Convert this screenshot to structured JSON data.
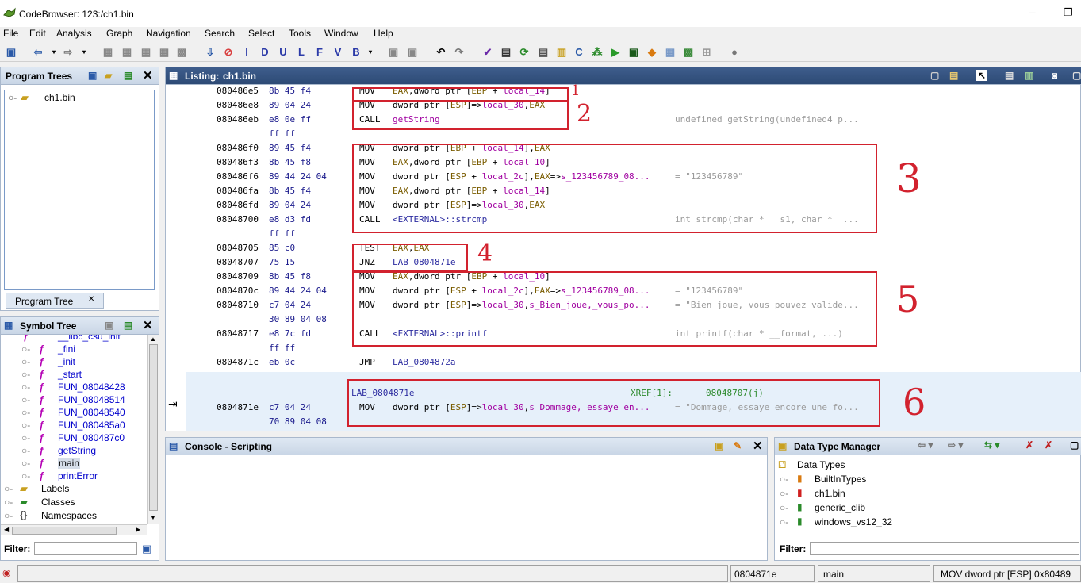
{
  "window": {
    "title": "CodeBrowser: 123:/ch1.bin",
    "min": "─",
    "max": "❐"
  },
  "menu": [
    "File",
    "Edit",
    "Analysis",
    "Graph",
    "Navigation",
    "Search",
    "Select",
    "Tools",
    "Window",
    "Help"
  ],
  "program_trees": {
    "title": "Program Trees",
    "root": "ch1.bin",
    "tab": "Program Tree"
  },
  "symbol_tree": {
    "title": "Symbol Tree",
    "functions": [
      "__libc_csu_init",
      "_fini",
      "_init",
      "_start",
      "FUN_08048428",
      "FUN_08048514",
      "FUN_08048540",
      "FUN_080485a0",
      "FUN_080487c0",
      "getString",
      "main",
      "printError"
    ],
    "folders": [
      "Labels",
      "Classes",
      "Namespaces"
    ],
    "filter_label": "Filter:"
  },
  "listing": {
    "title": "Listing:",
    "file": "ch1.bin",
    "lines": [
      {
        "a": "080486e5",
        "b": "8b 45 f4",
        "m": "MOV",
        "o": [
          [
            "reg",
            "EAX"
          ],
          [
            "mn",
            ",dword ptr ["
          ],
          [
            "reg",
            "EBP"
          ],
          [
            "mn",
            " + "
          ],
          [
            "loc",
            "local_14"
          ],
          [
            "mn",
            "]"
          ]
        ],
        "c": ""
      },
      {
        "a": "080486e8",
        "b": "89 04 24",
        "m": "MOV",
        "o": [
          [
            "mn",
            "dword ptr ["
          ],
          [
            "reg",
            "ESP"
          ],
          [
            "mn",
            "]=>"
          ],
          [
            "loc",
            "local_30"
          ],
          [
            "mn",
            ","
          ],
          [
            "reg",
            "EAX"
          ]
        ],
        "c": ""
      },
      {
        "a": "080486eb",
        "b": "e8 0e ff",
        "m": "CALL",
        "o": [
          [
            "loc",
            "getString"
          ]
        ],
        "c": "undefined getString(undefined4 p..."
      },
      {
        "a": "",
        "b": "ff ff",
        "m": "",
        "o": [],
        "c": ""
      },
      {
        "a": "080486f0",
        "b": "89 45 f4",
        "m": "MOV",
        "o": [
          [
            "mn",
            "dword ptr ["
          ],
          [
            "reg",
            "EBP"
          ],
          [
            "mn",
            " + "
          ],
          [
            "loc",
            "local_14"
          ],
          [
            "mn",
            "],"
          ],
          [
            "reg",
            "EAX"
          ]
        ],
        "c": ""
      },
      {
        "a": "080486f3",
        "b": "8b 45 f8",
        "m": "MOV",
        "o": [
          [
            "reg",
            "EAX"
          ],
          [
            "mn",
            ",dword ptr ["
          ],
          [
            "reg",
            "EBP"
          ],
          [
            "mn",
            " + "
          ],
          [
            "loc",
            "local_10"
          ],
          [
            "mn",
            "]"
          ]
        ],
        "c": ""
      },
      {
        "a": "080486f6",
        "b": "89 44 24 04",
        "m": "MOV",
        "o": [
          [
            "mn",
            "dword ptr ["
          ],
          [
            "reg",
            "ESP"
          ],
          [
            "mn",
            " + "
          ],
          [
            "loc",
            "local_2c"
          ],
          [
            "mn",
            "],"
          ],
          [
            "reg",
            "EAX"
          ],
          [
            "mn",
            "=>"
          ],
          [
            "loc",
            "s_123456789_08..."
          ]
        ],
        "c": "= \"123456789\""
      },
      {
        "a": "080486fa",
        "b": "8b 45 f4",
        "m": "MOV",
        "o": [
          [
            "reg",
            "EAX"
          ],
          [
            "mn",
            ",dword ptr ["
          ],
          [
            "reg",
            "EBP"
          ],
          [
            "mn",
            " + "
          ],
          [
            "loc",
            "local_14"
          ],
          [
            "mn",
            "]"
          ]
        ],
        "c": ""
      },
      {
        "a": "080486fd",
        "b": "89 04 24",
        "m": "MOV",
        "o": [
          [
            "mn",
            "dword ptr ["
          ],
          [
            "reg",
            "ESP"
          ],
          [
            "mn",
            "]=>"
          ],
          [
            "loc",
            "local_30"
          ],
          [
            "mn",
            ","
          ],
          [
            "reg",
            "EAX"
          ]
        ],
        "c": ""
      },
      {
        "a": "08048700",
        "b": "e8 d3 fd",
        "m": "CALL",
        "o": [
          [
            "sym",
            "<EXTERNAL>::strcmp"
          ]
        ],
        "c": "int strcmp(char * __s1, char * _..."
      },
      {
        "a": "",
        "b": "ff ff",
        "m": "",
        "o": [],
        "c": ""
      },
      {
        "a": "08048705",
        "b": "85 c0",
        "m": "TEST",
        "o": [
          [
            "reg",
            "EAX"
          ],
          [
            "mn",
            ","
          ],
          [
            "reg",
            "EAX"
          ]
        ],
        "c": ""
      },
      {
        "a": "08048707",
        "b": "75 15",
        "m": "JNZ",
        "o": [
          [
            "sym",
            "LAB_0804871e"
          ]
        ],
        "c": ""
      },
      {
        "a": "08048709",
        "b": "8b 45 f8",
        "m": "MOV",
        "o": [
          [
            "reg",
            "EAX"
          ],
          [
            "mn",
            ",dword ptr ["
          ],
          [
            "reg",
            "EBP"
          ],
          [
            "mn",
            " + "
          ],
          [
            "loc",
            "local_10"
          ],
          [
            "mn",
            "]"
          ]
        ],
        "c": ""
      },
      {
        "a": "0804870c",
        "b": "89 44 24 04",
        "m": "MOV",
        "o": [
          [
            "mn",
            "dword ptr ["
          ],
          [
            "reg",
            "ESP"
          ],
          [
            "mn",
            " + "
          ],
          [
            "loc",
            "local_2c"
          ],
          [
            "mn",
            "],"
          ],
          [
            "reg",
            "EAX"
          ],
          [
            "mn",
            "=>"
          ],
          [
            "loc",
            "s_123456789_08..."
          ]
        ],
        "c": "= \"123456789\""
      },
      {
        "a": "08048710",
        "b": "c7 04 24",
        "m": "MOV",
        "o": [
          [
            "mn",
            "dword ptr ["
          ],
          [
            "reg",
            "ESP"
          ],
          [
            "mn",
            "]=>"
          ],
          [
            "loc",
            "local_30"
          ],
          [
            "mn",
            ","
          ],
          [
            "loc",
            "s_Bien_joue,_vous_po..."
          ]
        ],
        "c": "= \"Bien joue, vous pouvez valide..."
      },
      {
        "a": "",
        "b": "30 89 04 08",
        "m": "",
        "o": [],
        "c": ""
      },
      {
        "a": "08048717",
        "b": "e8 7c fd",
        "m": "CALL",
        "o": [
          [
            "sym",
            "<EXTERNAL>::printf"
          ]
        ],
        "c": "int printf(char * __format, ...)"
      },
      {
        "a": "",
        "b": "ff ff",
        "m": "",
        "o": [],
        "c": ""
      },
      {
        "a": "0804871c",
        "b": "eb 0c",
        "m": "JMP",
        "o": [
          [
            "sym",
            "LAB_0804872a"
          ]
        ],
        "c": ""
      }
    ],
    "label": {
      "name": "LAB_0804871e",
      "xref": "XREF[1]:",
      "xref_addr": "08048707(j)"
    },
    "last": {
      "a": "0804871e",
      "b": "c7 04 24",
      "m": "MOV",
      "o": [
        [
          "mn",
          "dword ptr ["
        ],
        [
          "reg",
          "ESP"
        ],
        [
          "mn",
          "]=>"
        ],
        [
          "loc",
          "local_30"
        ],
        [
          "mn",
          ","
        ],
        [
          "loc",
          "s_Dommage,_essaye_en..."
        ]
      ],
      "c": "= \"Dommage, essaye encore une fo..."
    },
    "last2": {
      "b": "70 89 04 08"
    }
  },
  "annotations": [
    "1",
    "2",
    "3",
    "4",
    "5",
    "6"
  ],
  "console": {
    "title": "Console - Scripting"
  },
  "data_types": {
    "title": "Data Type Manager",
    "root": "Data Types",
    "items": [
      "BuiltInTypes",
      "ch1.bin",
      "generic_clib",
      "windows_vs12_32"
    ],
    "filter_label": "Filter:"
  },
  "statusbar": {
    "address": "0804871e",
    "function": "main",
    "instruction": "MOV dword ptr [ESP],0x80489"
  }
}
